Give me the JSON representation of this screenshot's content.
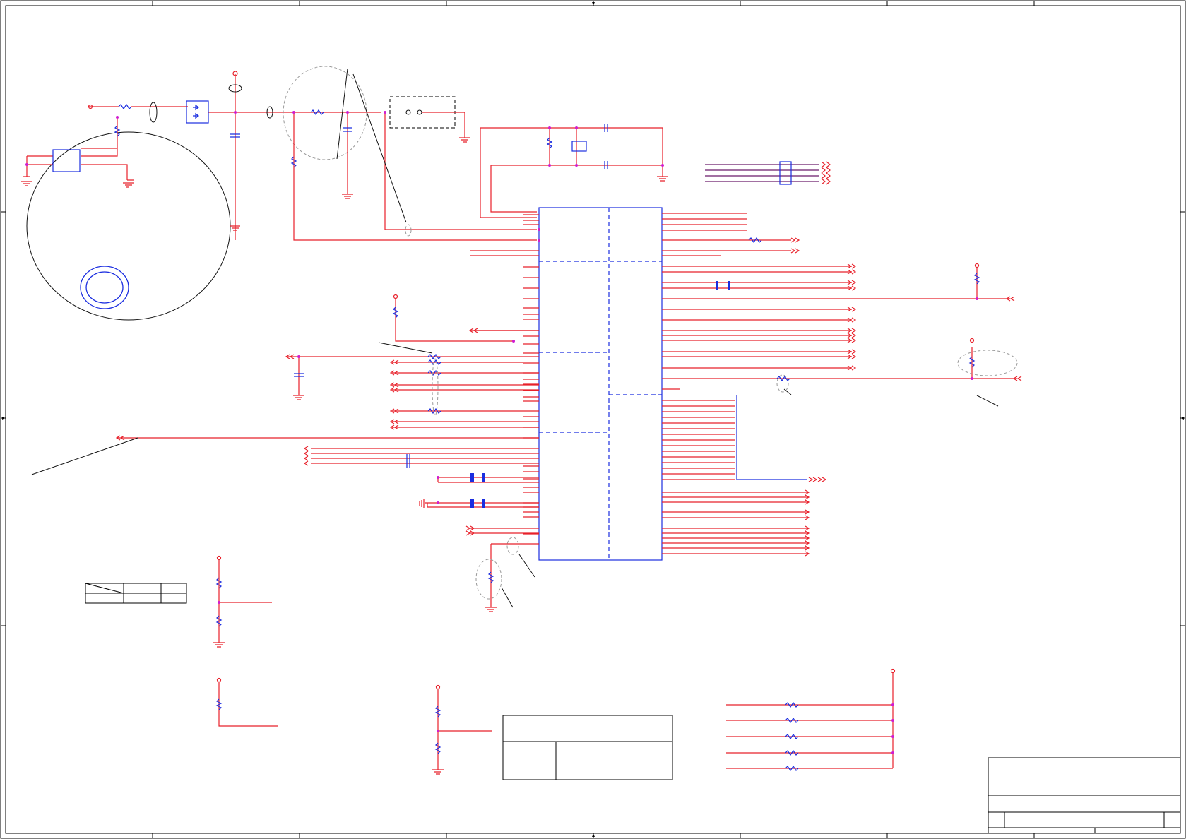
{
  "sheet": {
    "frame_color": "#000000",
    "wire_color": "#e8202a",
    "part_color": "#1a2de0",
    "junction_color": "#d01dd0"
  }
}
